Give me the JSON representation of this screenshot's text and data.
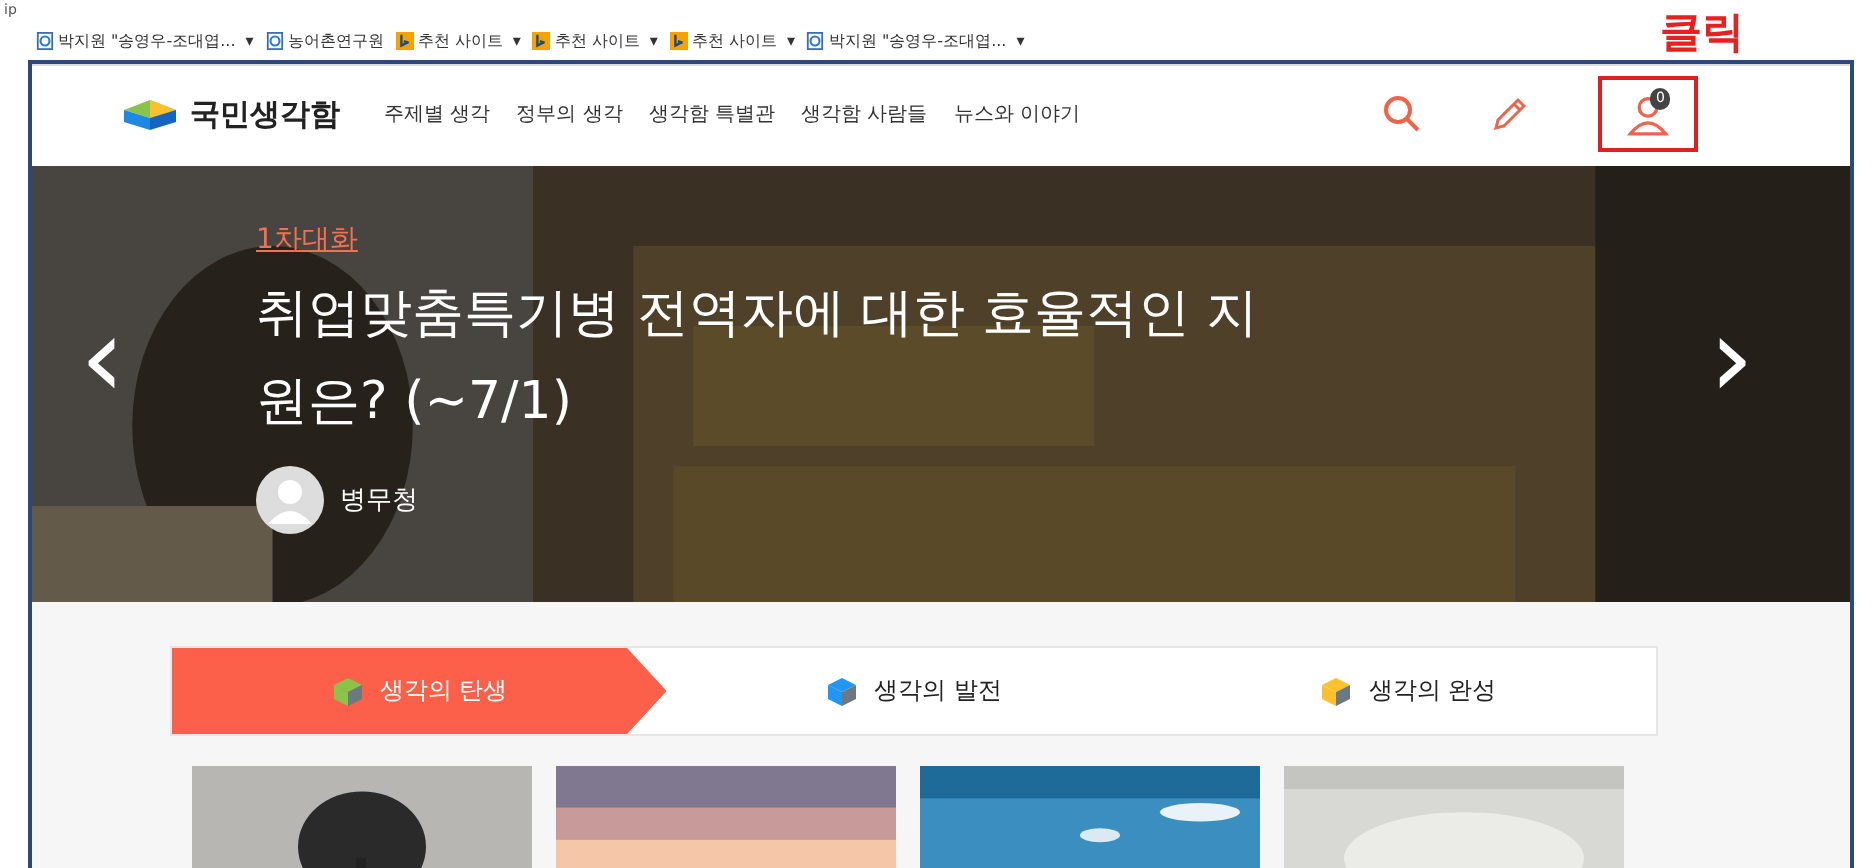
{
  "corner_text": "ip",
  "favorites": [
    {
      "label": "박지원 \"송영우-조대엽...",
      "kind": "ie",
      "dropdown": true
    },
    {
      "label": "농어촌연구원",
      "kind": "ie",
      "dropdown": false
    },
    {
      "label": "추천 사이트",
      "kind": "bing",
      "dropdown": true
    },
    {
      "label": "추천 사이트",
      "kind": "bing",
      "dropdown": true
    },
    {
      "label": "추천 사이트",
      "kind": "bing",
      "dropdown": true
    },
    {
      "label": "박지원 \"송영우-조대엽...",
      "kind": "ie",
      "dropdown": true
    }
  ],
  "dropdown_glyph": "▾",
  "logo": "국민생각함",
  "nav": [
    "주제별 생각",
    "정부의 생각",
    "생각함 특별관",
    "생각함 사람들",
    "뉴스와 이야기"
  ],
  "notification_count": "0",
  "annotation": "클릭",
  "hero": {
    "prev": "‹",
    "next": "›",
    "category": "1차대화",
    "title": "취업맞춤특기병 전역자에 대한 효율적인 지원은? (~7/1)",
    "author": "병무청"
  },
  "steps": [
    {
      "label": "생각의 탄생",
      "selected": true,
      "color": "#8bc34a"
    },
    {
      "label": "생각의 발전",
      "selected": false,
      "color": "#2196f3"
    },
    {
      "label": "생각의 완성",
      "selected": false,
      "color": "#fbc02d"
    }
  ],
  "thumbnails": [
    {
      "kind": "tree"
    },
    {
      "kind": "sunset"
    },
    {
      "kind": "sky"
    },
    {
      "kind": "fog"
    }
  ]
}
